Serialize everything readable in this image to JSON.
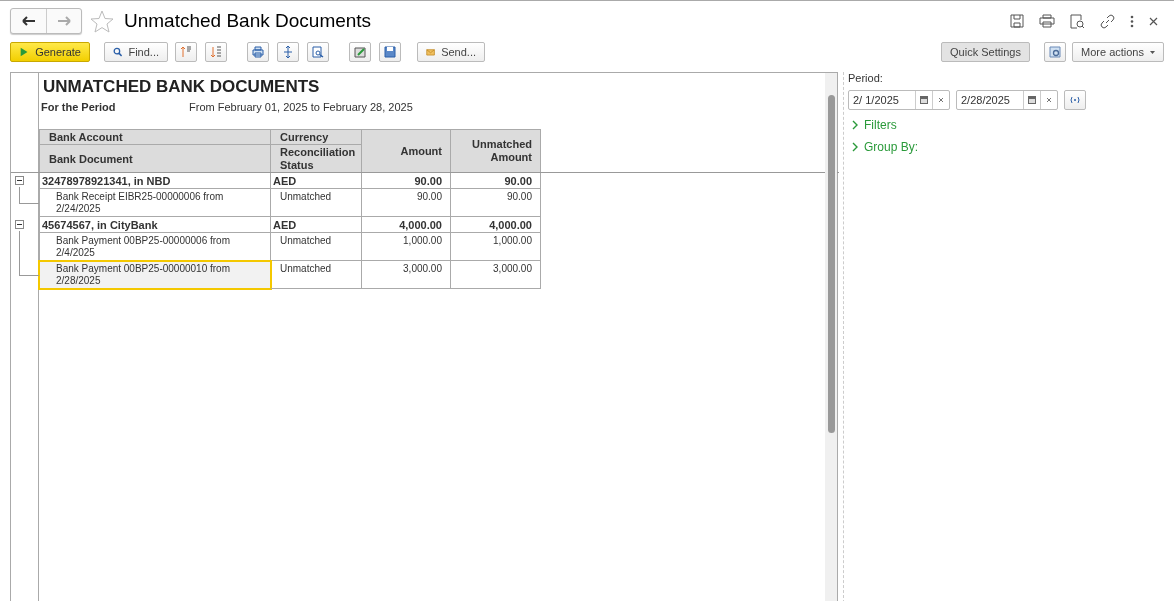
{
  "window": {
    "title": "Unmatched Bank Documents",
    "favorite": false
  },
  "toolbar": {
    "generate": "Generate",
    "find": "Find...",
    "send": "Send...",
    "quick_settings": "Quick Settings",
    "more_actions": "More actions"
  },
  "report": {
    "title": "UNMATCHED BANK DOCUMENTS",
    "period_label": "For the Period",
    "period_value": "From February 01, 2025 to February 28, 2025",
    "header": {
      "bank_account": "Bank Account",
      "currency": "Currency",
      "bank_document": "Bank Document",
      "reconciliation_status": "Reconciliation Status",
      "amount": "Amount",
      "unmatched_amount": "Unmatched Amount"
    },
    "groups": [
      {
        "account": "32478978921341, in NBD",
        "currency": "AED",
        "amount": "90.00",
        "unmatched_amount": "90.00",
        "expanded": true,
        "rows": [
          {
            "document": "Bank Receipt EIBR25-00000006 from 2/24/2025",
            "status": "Unmatched",
            "amount": "90.00",
            "unmatched_amount": "90.00",
            "selected": false
          }
        ]
      },
      {
        "account": "45674567, in CityBank",
        "currency": "AED",
        "amount": "4,000.00",
        "unmatched_amount": "4,000.00",
        "expanded": true,
        "rows": [
          {
            "document": "Bank Payment 00BP25-00000006 from 2/4/2025",
            "status": "Unmatched",
            "amount": "1,000.00",
            "unmatched_amount": "1,000.00",
            "selected": false
          },
          {
            "document": "Bank Payment 00BP25-00000010 from 2/28/2025",
            "status": "Unmatched",
            "amount": "3,000.00",
            "unmatched_amount": "3,000.00",
            "selected": true
          }
        ]
      }
    ]
  },
  "settings": {
    "period_label": "Period:",
    "date_from": "2/ 1/2025",
    "date_to": "2/28/2025",
    "sections": [
      {
        "label": "Filters",
        "expanded": false
      },
      {
        "label": "Group By:",
        "expanded": false
      }
    ]
  }
}
